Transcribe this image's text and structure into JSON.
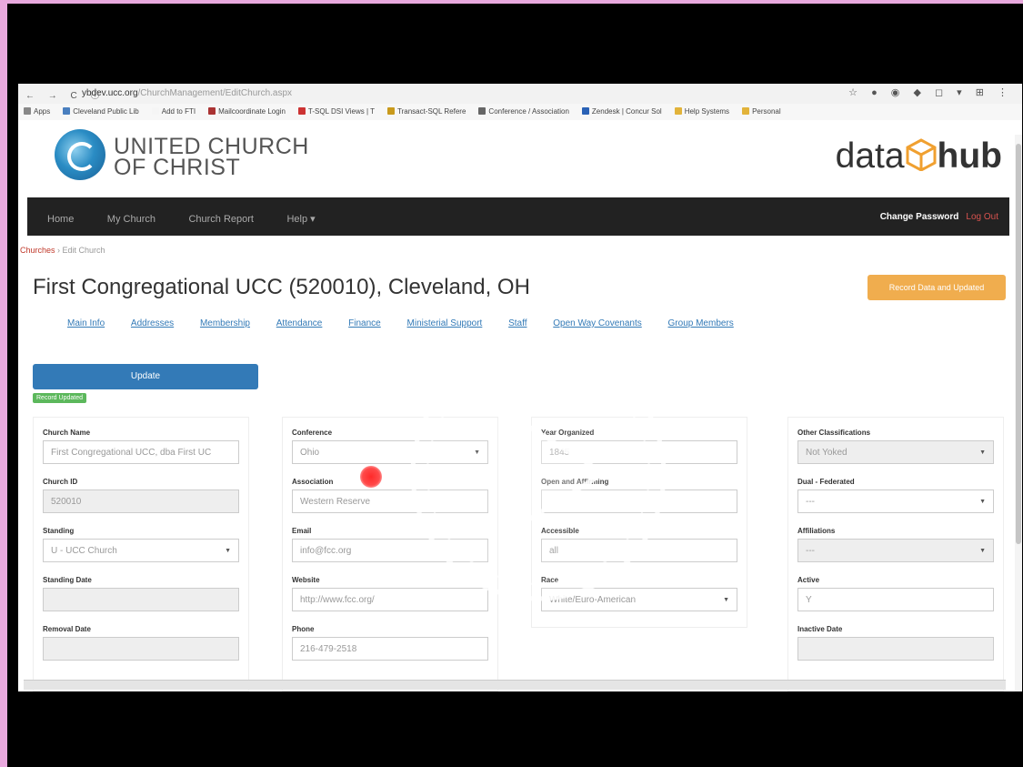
{
  "browser": {
    "url_host": "ybdev.ucc.org",
    "url_path": "/ChurchManagement/EditChurch.aspx",
    "bookmarks": [
      "Apps",
      "Cleveland Public Lib",
      "Add to FTI",
      "Mailcoordinate Login",
      "T-SQL DSI Views | T",
      "Transact-SQL Refere",
      "Conference / Association",
      "Zendesk | Concur Sol",
      "Help Systems",
      "Personal"
    ]
  },
  "header": {
    "logo_line1": "UNITED CHURCH",
    "logo_line2": "OF CHRIST",
    "brand_left": "data",
    "brand_right": "hub"
  },
  "nav": {
    "items": [
      "Home",
      "My Church",
      "Church Report",
      "Help ▾"
    ],
    "change_password": "Change Password",
    "logout": "Log Out"
  },
  "breadcrumb": {
    "home": "Churches",
    "sep": " › ",
    "current": "Edit Church"
  },
  "page_title": "First Congregational UCC (520010), Cleveland, OH",
  "orange_button": "Record Data and Updated",
  "tabs": [
    "Main Info",
    "Addresses",
    "Membership",
    "Attendance",
    "Finance",
    "Ministerial Support",
    "Staff",
    "Open Way Covenants",
    "Group Members"
  ],
  "update_button": "Update",
  "badge": "Record Updated",
  "col1": {
    "church_name_label": "Church Name",
    "church_name_value": "First Congregational UCC, dba First UC",
    "church_id_label": "Church ID",
    "church_id_value": "520010",
    "standing_label": "Standing",
    "standing_value": "U - UCC Church",
    "standing_date_label": "Standing Date",
    "removal_date_label": "Removal Date"
  },
  "col2": {
    "conference_label": "Conference",
    "conference_value": "Ohio",
    "association_label": "Association",
    "association_value": "Western Reserve",
    "email_label": "Email",
    "email_value": "info@fcc.org",
    "website_label": "Website",
    "website_value": "http://www.fcc.org/",
    "phone_label": "Phone",
    "phone_value": "216-479-2518"
  },
  "col3": {
    "year_label": "Year Organized",
    "year_value": "1845",
    "oa_label": "Open and Affirming",
    "accessible_label": "Accessible",
    "accessible_value": "all",
    "race_label": "Race",
    "race_value": "White/Euro-American"
  },
  "col4": {
    "other_label": "Other Classifications",
    "other_value": "Not Yoked",
    "dual_label": "Dual - Federated",
    "dual_value": "---",
    "affiliations_label": "Affiliations",
    "affiliations_value": "---",
    "active_label": "Active",
    "active_value": "Y",
    "inactive_label": "Inactive Date"
  }
}
